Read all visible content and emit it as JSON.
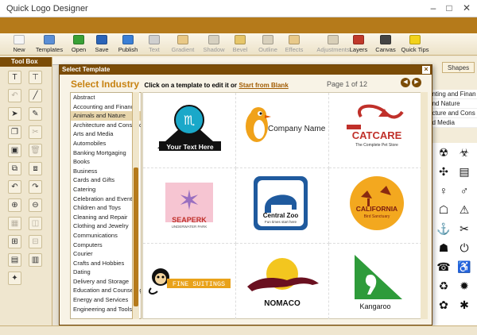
{
  "window": {
    "title": "Quick Logo Designer",
    "minimize": "–",
    "maximize": "□",
    "close": "✕"
  },
  "toolbar": [
    {
      "label": "New",
      "icon": "new-file-icon",
      "color": "#f5f5f5",
      "enabled": true
    },
    {
      "label": "Templates",
      "icon": "templates-icon",
      "color": "#5b8fd6",
      "enabled": true
    },
    {
      "label": "Open",
      "icon": "open-folder-icon",
      "color": "#39a136",
      "enabled": true
    },
    {
      "label": "Save",
      "icon": "save-disk-icon",
      "color": "#2b64b8",
      "enabled": true
    },
    {
      "label": "Publish",
      "icon": "publish-icon",
      "color": "#3a7fd6",
      "enabled": true
    },
    {
      "label": "Text",
      "icon": "text-icon",
      "color": "#cfcfcf",
      "enabled": false
    },
    {
      "label": "Gradient",
      "icon": "gradient-icon",
      "color": "#e9c987",
      "enabled": false
    },
    {
      "label": "Shadow",
      "icon": "shadow-icon",
      "color": "#d6d0c0",
      "enabled": false
    },
    {
      "label": "Bevel",
      "icon": "bevel-icon",
      "color": "#e6c66a",
      "enabled": false
    },
    {
      "label": "Outline",
      "icon": "outline-icon",
      "color": "#d8d0bc",
      "enabled": false
    },
    {
      "label": "Effects",
      "icon": "effects-icon",
      "color": "#e8c98a",
      "enabled": false
    },
    {
      "label": "Adjustments",
      "icon": "adjustments-icon",
      "color": "#d8cfb8",
      "enabled": false
    },
    {
      "label": "Layers",
      "icon": "layers-icon",
      "color": "#c0392b",
      "enabled": true
    },
    {
      "label": "Canvas",
      "icon": "canvas-icon",
      "color": "#444444",
      "enabled": true
    },
    {
      "label": "Quick Tips",
      "icon": "lightbulb-icon",
      "color": "#f2d21b",
      "enabled": true
    }
  ],
  "toolbox": {
    "title": "Tool Box",
    "tools": [
      {
        "glyph": "T",
        "name": "text-tool-icon"
      },
      {
        "glyph": "⊤",
        "name": "text-frame-icon"
      },
      {
        "glyph": "↶",
        "name": "undo-icon",
        "dim": true
      },
      {
        "glyph": "╱",
        "name": "line-tool-icon"
      },
      {
        "glyph": "➤",
        "name": "select-arrow-icon"
      },
      {
        "glyph": "✎",
        "name": "pen-tool-icon"
      },
      {
        "glyph": "❐",
        "name": "copy-icon"
      },
      {
        "glyph": "✂",
        "name": "cut-icon",
        "dim": true
      },
      {
        "glyph": "▣",
        "name": "paste-icon"
      },
      {
        "glyph": "🗑",
        "name": "delete-icon",
        "dim": true
      },
      {
        "glyph": "⧉",
        "name": "duplicate-icon"
      },
      {
        "glyph": "⧈",
        "name": "arrange-icon"
      },
      {
        "glyph": "↶",
        "name": "rotate-left-icon"
      },
      {
        "glyph": "↷",
        "name": "rotate-right-icon"
      },
      {
        "glyph": "⊕",
        "name": "zoom-in-icon"
      },
      {
        "glyph": "⊖",
        "name": "zoom-out-icon"
      },
      {
        "glyph": "▦",
        "name": "grid-icon",
        "dim": true
      },
      {
        "glyph": "◫",
        "name": "align-icon",
        "dim": true
      },
      {
        "glyph": "⊞",
        "name": "group-icon"
      },
      {
        "glyph": "⊟",
        "name": "ungroup-icon",
        "dim": true
      },
      {
        "glyph": "▤",
        "name": "fit-icon"
      },
      {
        "glyph": "▥",
        "name": "properties-icon"
      },
      {
        "glyph": "✦",
        "name": "color-picker-icon"
      }
    ]
  },
  "right_panel": {
    "tabs": [
      "Shapes"
    ],
    "list_items": [
      "unting and Finan",
      "and Nature",
      "ecture and Cons",
      "nd Media"
    ]
  },
  "dialog": {
    "title": "Select Template",
    "close": "×",
    "heading": "Select Industry",
    "hint": "Click on a template to edit it or",
    "start_blank": "Start from Blank",
    "page_info": "Page 1 of 12",
    "prev": "◀",
    "next": "▶",
    "industries": [
      "Abstract",
      "Accounting and Finance",
      "Animals and Nature",
      "Architecture and Construction",
      "Arts and Media",
      "Automobiles",
      "Banking Mortgaging",
      "Books",
      "Business",
      "Cards and Gifts",
      "Catering",
      "Celebration and Events",
      "Children and Toys",
      "Cleaning and Repair",
      "Clothing and Jewelry",
      "Communications",
      "Computers",
      "Courier",
      "Crafts and Hobbies",
      "Dating",
      "Delivery and Storage",
      "Education and Counseling",
      "Energy and Services",
      "Engineering and Tools"
    ],
    "selected_industry": "Animals and Nature",
    "templates": [
      {
        "id": "scorpion",
        "text": "Your Text Here"
      },
      {
        "id": "company",
        "text": "Company Name"
      },
      {
        "id": "catcare",
        "text": "CATCARE",
        "sub": "The Complete Pet Store"
      },
      {
        "id": "seaperk",
        "text": "SEAPERK",
        "sub": "UNDERWATER PARK"
      },
      {
        "id": "centralzoo",
        "text": "Central Zoo",
        "sub": "Fun times start here"
      },
      {
        "id": "california",
        "text": "CALIFORNIA",
        "sub": "Bird Sanctuary"
      },
      {
        "id": "finesuitings",
        "text": "FINE SUITINGS"
      },
      {
        "id": "nomaco",
        "text": "NOMACO"
      },
      {
        "id": "kangaroo",
        "text": "Kangaroo"
      }
    ]
  }
}
